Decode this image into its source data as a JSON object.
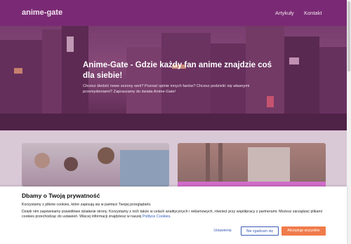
{
  "nav": {
    "logo": "anime-gate",
    "links": [
      {
        "label": "Artykuły"
      },
      {
        "label": "Kontakt"
      }
    ]
  },
  "hero": {
    "title": "Anime-Gate - Gdzie każdy fan anime znajdzie coś dla siebie!",
    "subtitle": "Chcesz śledzić nowe sezony serii? Poznać opinie innych fanów? Chcesz podzielić się własnymi przemyśleniami? Zapraszamy do świata Anime-Gate!"
  },
  "cookie": {
    "title": "Dbamy o Twoją prywatność",
    "line1": "Korzystamy z plików cookies, które zapisują się w pamięci Twojej przeglądarki.",
    "line2": "Dzięki nim zapewniamy prawidłowe działanie strony. Korzystamy z nich także w celach analitycznych i reklamowych, również przy współpracy z partnerami. Możesz zarządzać plikami cookies przechodząc do ustawień. Więcej informacji znajdziesz w naszej",
    "policy_link": "Polityce Cookies",
    "buttons": {
      "settings": "Ustawienia",
      "reject": "Nie zgadzam się",
      "accept": "Akceptuję wszystkie"
    }
  },
  "colors": {
    "nav": "#7a2a74",
    "accept": "#f07b4a",
    "link": "#2c55b8"
  }
}
